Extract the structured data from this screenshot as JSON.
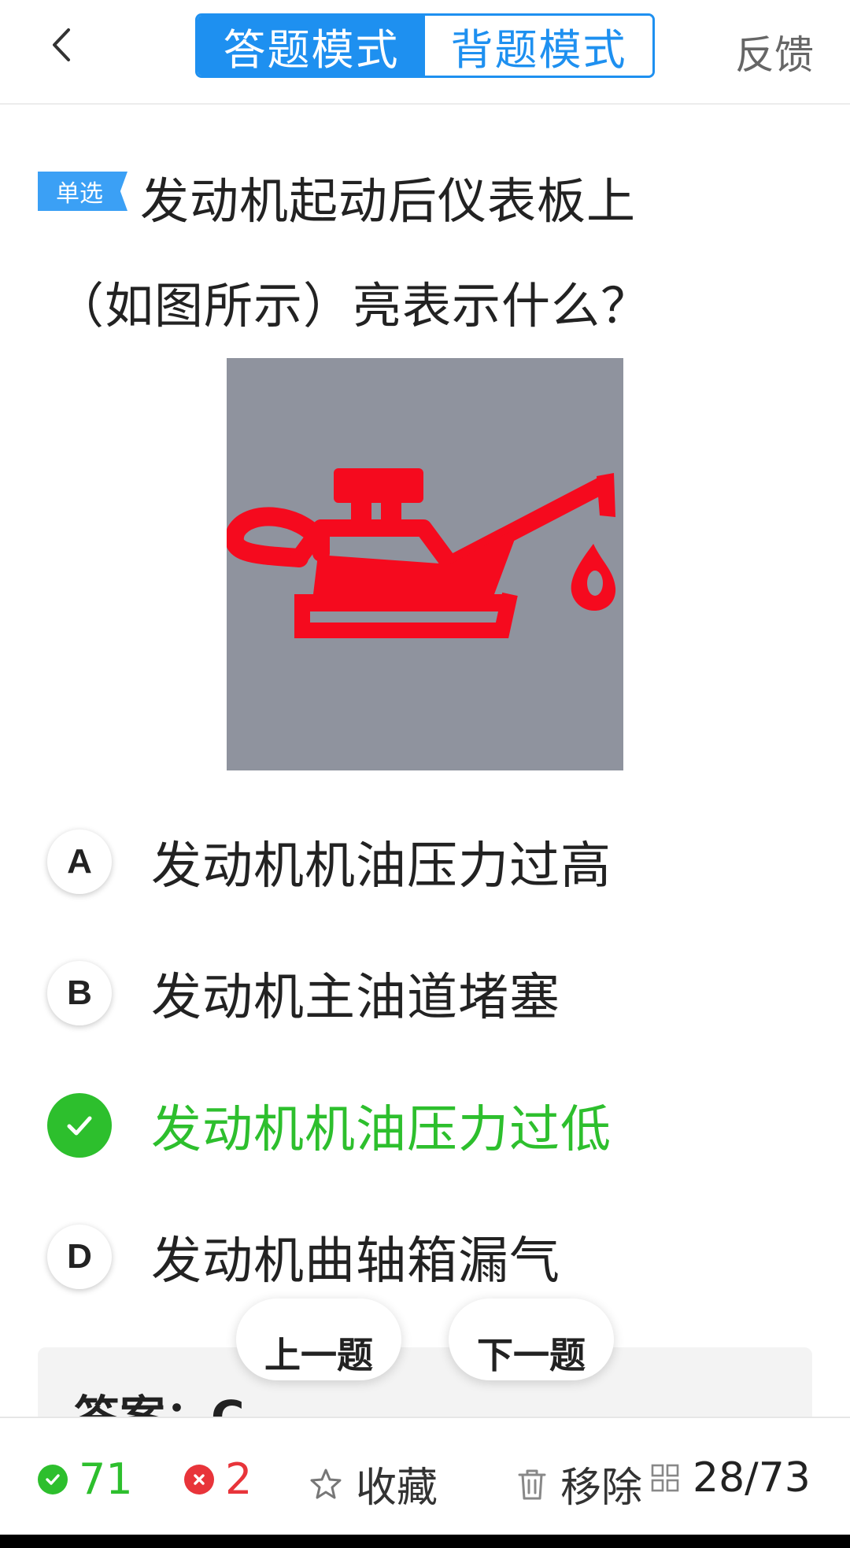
{
  "header": {
    "tabs": [
      {
        "label": "答题模式",
        "active": true
      },
      {
        "label": "背题模式",
        "active": false
      }
    ],
    "feedback_label": "反馈"
  },
  "question": {
    "type_badge": "单选",
    "line1": "发动机起动后仪表板上",
    "line2": "（如图所示）亮表示什么？",
    "image_icon": "oil-pressure-warning-icon"
  },
  "options": [
    {
      "letter": "A",
      "text": "发动机机油压力过高",
      "correct": false
    },
    {
      "letter": "B",
      "text": "发动机主油道堵塞",
      "correct": false
    },
    {
      "letter": "C",
      "text": "发动机机油压力过低",
      "correct": true
    },
    {
      "letter": "D",
      "text": "发动机曲轴箱漏气",
      "correct": false
    }
  ],
  "navigation": {
    "prev_label": "上一题",
    "next_label": "下一题"
  },
  "answer": {
    "text": "答案：C"
  },
  "bottom_bar": {
    "correct_count": "71",
    "wrong_count": "2",
    "favorite_label": "收藏",
    "remove_label": "移除",
    "progress": "28/73"
  },
  "colors": {
    "accent": "#1e90f0",
    "correct": "#2dbf2d",
    "wrong": "#e8343a",
    "warning_red": "#f50a1e",
    "image_bg": "#8f939e"
  }
}
